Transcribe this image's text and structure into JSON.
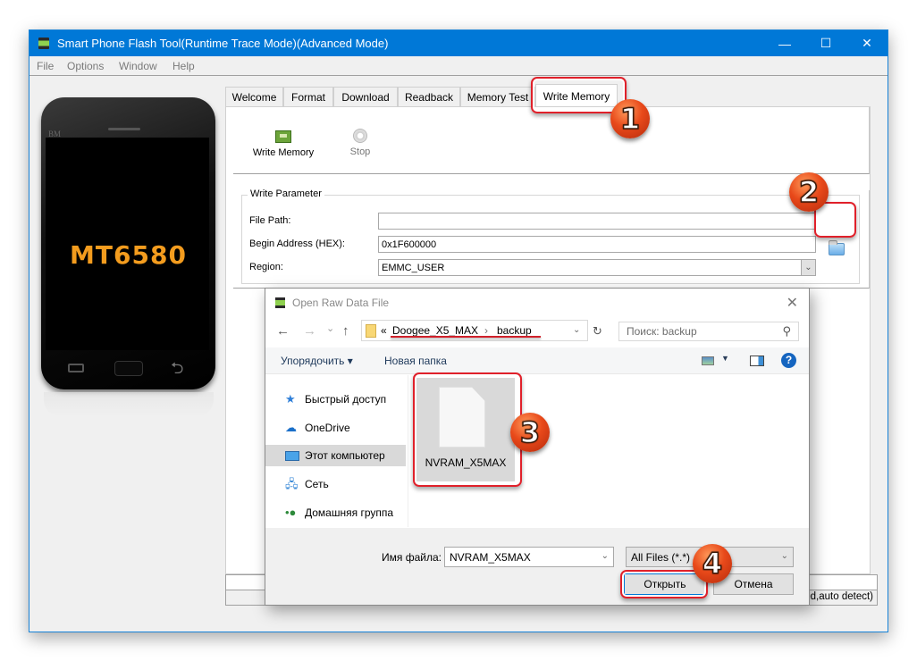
{
  "window": {
    "title": "Smart Phone Flash Tool(Runtime Trace Mode)(Advanced Mode)",
    "controls": {
      "minimize": "—",
      "maximize": "☐",
      "close": "✕"
    }
  },
  "menu": [
    "File",
    "Options",
    "Window",
    "Help"
  ],
  "phone": {
    "brand": "BM",
    "chip": "MT6580"
  },
  "tabs": [
    {
      "label": "Welcome",
      "active": false
    },
    {
      "label": "Format",
      "active": false
    },
    {
      "label": "Download",
      "active": false
    },
    {
      "label": "Readback",
      "active": false
    },
    {
      "label": "Memory Test",
      "active": false
    },
    {
      "label": "Write Memory",
      "active": true
    }
  ],
  "toolbar": {
    "write_memory": "Write Memory",
    "stop": "Stop"
  },
  "write_parameter": {
    "legend": "Write Parameter",
    "file_path_label": "File Path:",
    "file_path_value": "",
    "begin_address_label": "Begin Address (HEX):",
    "begin_address_value": "0x1F600000",
    "region_label": "Region:",
    "region_value": "EMMC_USER"
  },
  "status": {
    "text": "ed,auto detect)"
  },
  "callouts": [
    "1",
    "2",
    "3",
    "4"
  ],
  "dialog": {
    "title": "Open Raw Data File",
    "close": "✕",
    "nav": {
      "back": "←",
      "forward": "→",
      "recent": "⌄",
      "up": "↑",
      "refresh": "↻"
    },
    "address": {
      "prefix": "«",
      "crumbs": [
        "Doogee_X5_MAX",
        "backup"
      ],
      "separator": "›"
    },
    "search_placeholder": "Поиск: backup",
    "toolbar": {
      "organize": "Упорядочить ▾",
      "new_folder": "Новая папка"
    },
    "sidebar": [
      {
        "label": "Быстрый доступ",
        "icon": "star-icon",
        "selected": false
      },
      {
        "label": "OneDrive",
        "icon": "cloud-icon",
        "selected": false
      },
      {
        "label": "Этот компьютер",
        "icon": "computer-icon",
        "selected": true
      },
      {
        "label": "Сеть",
        "icon": "network-icon",
        "selected": false
      },
      {
        "label": "Домашняя группа",
        "icon": "homegroup-icon",
        "selected": false
      }
    ],
    "files": [
      {
        "name": "NVRAM_X5MAX",
        "selected": true
      }
    ],
    "filename_label": "Имя файла:",
    "filename_value": "NVRAM_X5MAX",
    "filter_value": "All Files (*.*)",
    "open_button": "Открыть",
    "cancel_button": "Отмена"
  }
}
